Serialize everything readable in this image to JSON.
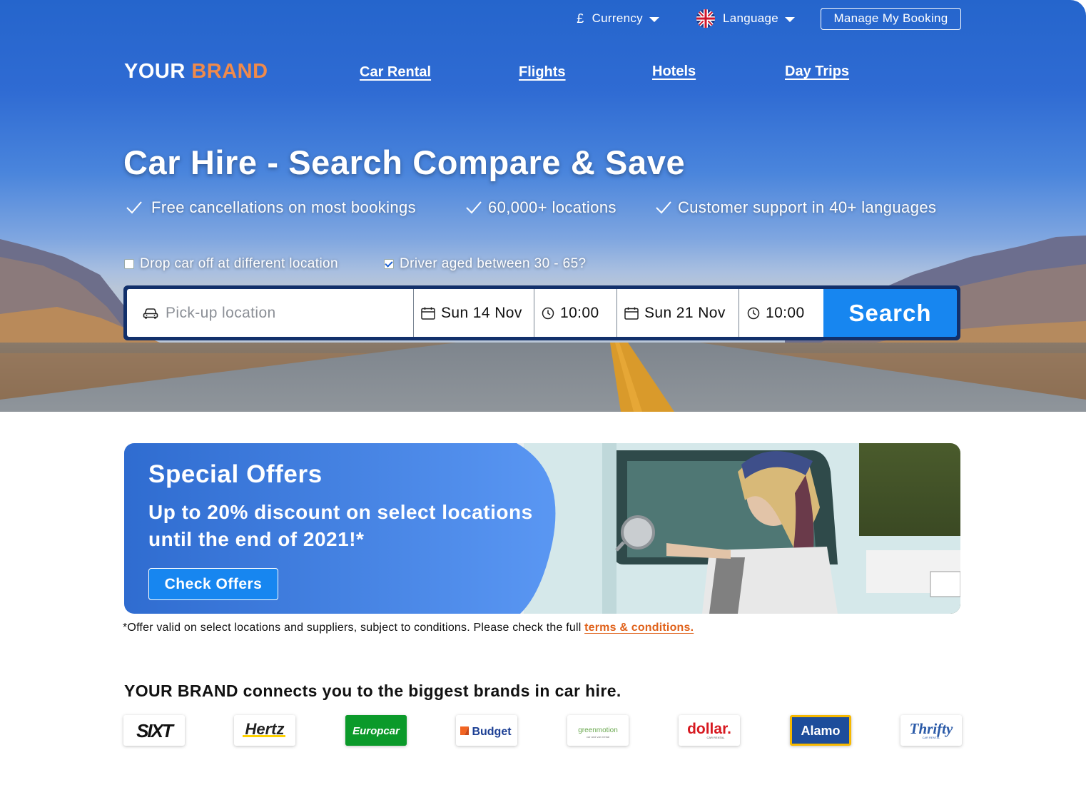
{
  "topbar": {
    "currency_symbol": "£",
    "currency_label": "Currency",
    "language_label": "Language",
    "manage_booking_label": "Manage My Booking"
  },
  "brand": {
    "part1": "YOUR ",
    "part2": "BRAND"
  },
  "nav": {
    "items": [
      "Car Rental",
      "Flights",
      "Hotels",
      "Day Trips"
    ]
  },
  "hero": {
    "title": "Car Hire - Search Compare & Save",
    "usps": [
      "Free cancellations on most bookings",
      "60,000+ locations",
      "Customer support in 40+ languages"
    ]
  },
  "search_options": {
    "drop_off_label": "Drop car off at different location",
    "drop_off_checked": false,
    "driver_age_label": "Driver aged between 30 - 65?",
    "driver_age_checked": true
  },
  "search": {
    "pickup_placeholder": "Pick-up location",
    "pickup_date": "Sun 14 Nov",
    "pickup_time": "10:00",
    "dropoff_date": "Sun 21 Nov",
    "dropoff_time": "10:00",
    "button_label": "Search"
  },
  "offers": {
    "title": "Special Offers",
    "text": "Up to 20% discount on select locations until the end of 2021!*",
    "button_label": "Check Offers",
    "disclaimer": "*Offer valid on select locations and suppliers, subject to conditions. Please check the full ",
    "terms_link": "terms & conditions."
  },
  "partners": {
    "heading": "YOUR BRAND connects you to the biggest brands in car hire.",
    "logos": [
      "SIXT",
      "Hertz",
      "Europcar",
      "Budget",
      "greenmotion",
      "dollar.",
      "Alamo",
      "Thrifty"
    ],
    "logo_sublabels": {
      "greenmotion": "car and van rental",
      "dollar": "CAR RENTAL",
      "thrifty": "CAR RENTAL"
    }
  },
  "colors": {
    "primary_blue": "#2565cc",
    "button_blue": "#1786f0",
    "accent_orange": "#f08a4b",
    "link_orange": "#e0621b",
    "searchbar_border": "#12306b"
  }
}
